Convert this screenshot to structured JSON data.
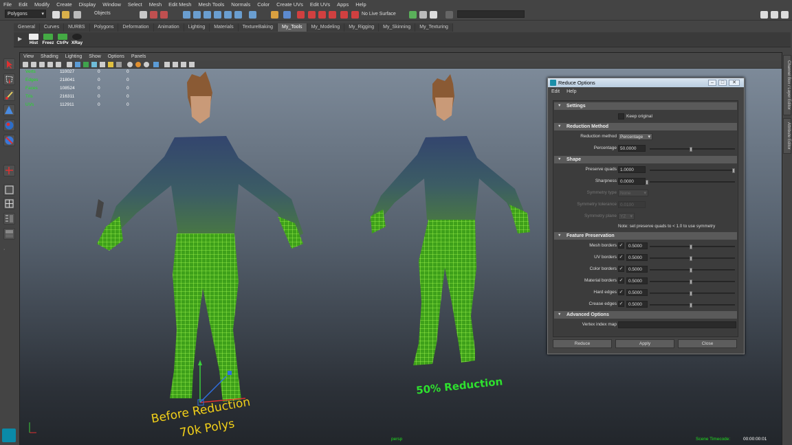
{
  "menubar": [
    "File",
    "Edit",
    "Modify",
    "Create",
    "Display",
    "Window",
    "Select",
    "Mesh",
    "Edit Mesh",
    "Mesh Tools",
    "Normals",
    "Color",
    "Create UVs",
    "Edit UVs",
    "Apps",
    "Help"
  ],
  "statusline": {
    "mode": "Polygons",
    "objects_label": "Objects",
    "live_surface": "No Live Surface"
  },
  "shelf": {
    "tabs": [
      "General",
      "Curves",
      "NURBS",
      "Polygons",
      "Deformation",
      "Animation",
      "Lighting",
      "Materials",
      "TextureBaking",
      "My_Tools",
      "My_Modeling",
      "My_Rigging",
      "My_Skinning",
      "My_Texturing"
    ],
    "active_tab": "My_Tools",
    "buttons": [
      "Hist",
      "Freez",
      "CtrPv",
      "XRay"
    ]
  },
  "viewport": {
    "menu": [
      "View",
      "Shading",
      "Lighting",
      "Show",
      "Options",
      "Panels"
    ],
    "hud": [
      {
        "label": "Verts",
        "v1": "110027",
        "v2": "0",
        "v3": "0"
      },
      {
        "label": "Edges",
        "v1": "218041",
        "v2": "0",
        "v3": "0"
      },
      {
        "label": "Faces",
        "v1": "108524",
        "v2": "0",
        "v3": "0"
      },
      {
        "label": "Tris",
        "v1": "216311",
        "v2": "0",
        "v3": "0"
      },
      {
        "label": "UVs",
        "v1": "112911",
        "v2": "0",
        "v3": "0"
      }
    ],
    "camera": "persp",
    "timecode_label": "Scene Timecode:",
    "timecode": "00:00:00:01",
    "annotation_left_1": "Before Reduction",
    "annotation_left_2": "70k Polys",
    "annotation_right": "50% Reduction"
  },
  "right_tabs": [
    "Channel Box / Layer Editor",
    "Attribute Editor"
  ],
  "dialog": {
    "title": "Reduce Options",
    "menu": [
      "Edit",
      "Help"
    ],
    "sections": {
      "settings": "Settings",
      "reduction_method": "Reduction Method",
      "shape": "Shape",
      "feature_preservation": "Feature Preservation",
      "advanced": "Advanced Options"
    },
    "keep_original": "Keep original",
    "reduction_method_label": "Reduction method",
    "reduction_method_value": "Percentage",
    "percentage_label": "Percentage",
    "percentage_value": "50.0000",
    "preserve_quads_label": "Preserve quads",
    "preserve_quads_value": "1.0000",
    "sharpness_label": "Sharpness",
    "sharpness_value": "0.0000",
    "symmetry_type_label": "Symmetry type",
    "symmetry_type_value": "None",
    "symmetry_tolerance_label": "Symmetry tolerance",
    "symmetry_tolerance_value": "0.0100",
    "symmetry_plane_label": "Symmetry plane",
    "symmetry_plane_value": "YZ",
    "note": "Note: set preserve quads to < 1.0 to use symmetry",
    "borders": [
      {
        "label": "Mesh borders",
        "value": "0.5000"
      },
      {
        "label": "UV borders",
        "value": "0.5000"
      },
      {
        "label": "Color borders",
        "value": "0.5000"
      },
      {
        "label": "Material borders",
        "value": "0.5000"
      },
      {
        "label": "Hard edges",
        "value": "0.5000"
      },
      {
        "label": "Crease edges",
        "value": "0.5000"
      }
    ],
    "vertex_index_map_label": "Vertex index map",
    "buttons": {
      "reduce": "Reduce",
      "apply": "Apply",
      "close": "Close"
    }
  }
}
